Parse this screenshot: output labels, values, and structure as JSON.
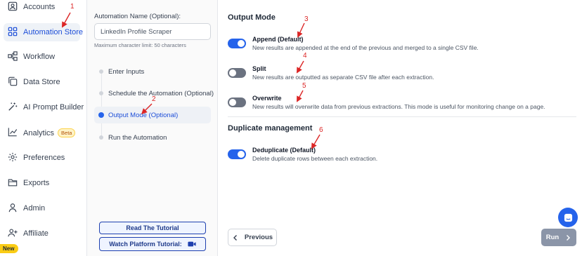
{
  "sidebar": {
    "items": [
      {
        "label": "Accounts",
        "icon": "user-square-icon"
      },
      {
        "label": "Automation Store",
        "icon": "grid-icon",
        "active": true
      },
      {
        "label": "Workflow",
        "icon": "workflow-icon"
      },
      {
        "label": "Data Store",
        "icon": "copy-icon"
      },
      {
        "label": "AI Prompt Builder",
        "icon": "magic-wand-icon"
      },
      {
        "label": "Analytics",
        "icon": "chart-line-icon",
        "badge": "Beta"
      },
      {
        "label": "Preferences",
        "icon": "gear-icon"
      },
      {
        "label": "Exports",
        "icon": "folder-icon"
      },
      {
        "label": "Admin",
        "icon": "person-icon"
      },
      {
        "label": "Affiliate",
        "icon": "people-plus-icon"
      }
    ],
    "new_badge": "New"
  },
  "config": {
    "name_label": "Automation Name (Optional):",
    "name_value": "LinkedIn Profile Scraper",
    "name_hint": "Maximum character limit: 50 characters",
    "steps": [
      {
        "label": "Enter Inputs"
      },
      {
        "label": "Schedule the Automation (Optional)"
      },
      {
        "label": "Output Mode (Optional)",
        "active": true
      },
      {
        "label": "Run the Automation"
      }
    ],
    "read_tutorial": "Read The Tutorial",
    "watch_tutorial": "Watch Platform Tutorial:"
  },
  "output_mode": {
    "title": "Output Mode",
    "options": [
      {
        "title": "Append (Default)",
        "desc": "New results are appended at the end of the previous and merged to a single CSV file.",
        "enabled": true
      },
      {
        "title": "Split",
        "desc": "New results are outputted as separate CSV file after each extraction.",
        "enabled": false
      },
      {
        "title": "Overwrite",
        "desc": "New results will overwrite data from previous extractions. This mode is useful for monitoring change on a page.",
        "enabled": false
      }
    ]
  },
  "duplicate": {
    "title": "Duplicate management",
    "option": {
      "title": "Deduplicate (Default)",
      "desc": "Delete duplicate rows between each extraction.",
      "enabled": true
    }
  },
  "buttons": {
    "previous": "Previous",
    "run": "Run"
  },
  "annotations": [
    "1",
    "2",
    "3",
    "4",
    "5",
    "6"
  ],
  "colors": {
    "accent": "#2563eb",
    "annotation": "#dc2626",
    "toggle_off": "#6b7280",
    "run_disabled": "#8b95a8"
  }
}
